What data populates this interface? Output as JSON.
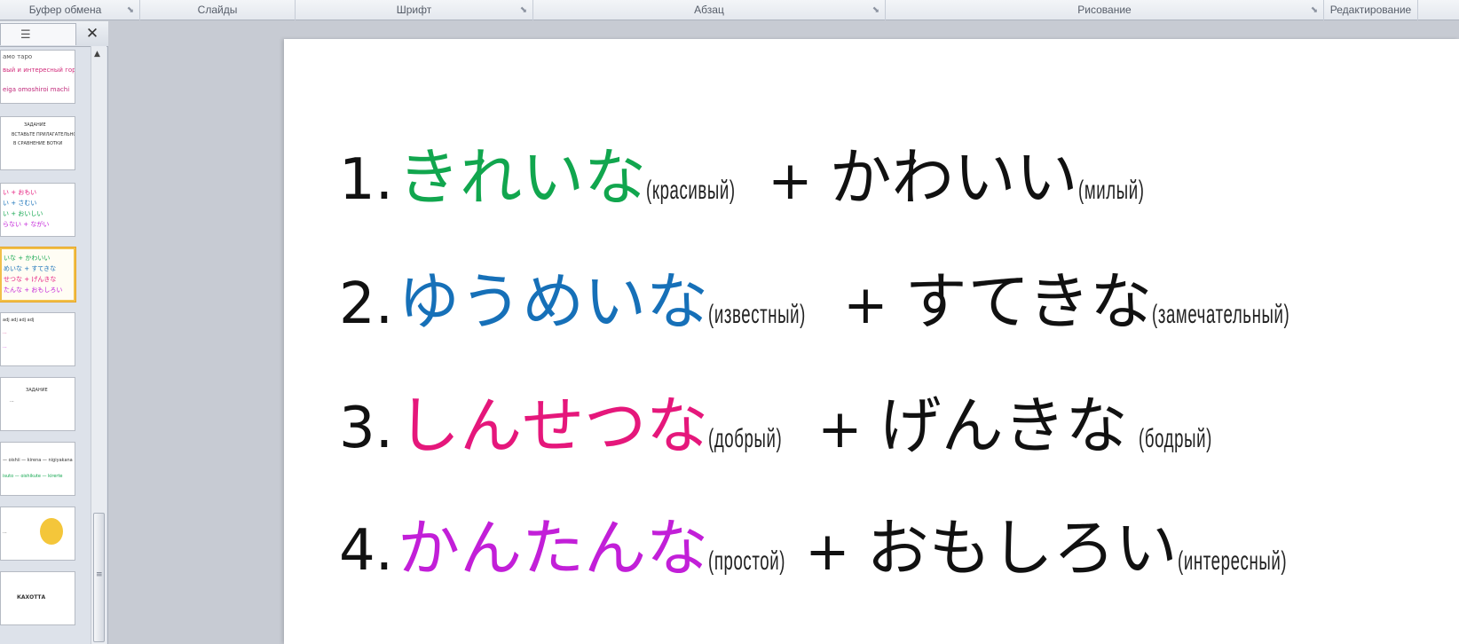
{
  "ribbon": {
    "groups": [
      {
        "label": "Буфер обмена"
      },
      {
        "label": "Слайды"
      },
      {
        "label": "Шрифт"
      },
      {
        "label": "Абзац"
      },
      {
        "label": "Рисование"
      },
      {
        "label": "Редактирование"
      }
    ]
  },
  "pane": {
    "close_glyph": "✕",
    "thumbnails": [
      {
        "lines": [
          "амо таро",
          "вый и интересный город",
          "eiga omoshiroi machi"
        ]
      },
      {
        "lines": [
          "ЗАДАНИЕ",
          "ВСТАВЬТЕ ПРИЛАГАТЕЛЬНОЕ",
          "В СРАВНЕНИЕ ВОТКИ"
        ]
      },
      {
        "lines": [
          "い + おもい",
          "い + さむい",
          "い + おいしい",
          "らない + ながい"
        ]
      },
      {
        "lines": [
          "いな + かわいい",
          "めいな + すてきな",
          "せつな + げんきな",
          "たんな + おもしろい"
        ]
      },
      {
        "lines": [
          "adj adj adj adj",
          "...",
          "..."
        ]
      },
      {
        "lines": [
          "ЗАДАНИЕ",
          "..."
        ]
      },
      {
        "lines": [
          "— oishii — kirena — nigiyakana",
          "isuto — oishikute — kirerte"
        ]
      },
      {
        "lines": [
          "..."
        ]
      },
      {
        "lines": [
          "КАХОТТА"
        ]
      }
    ]
  },
  "slide": {
    "rows": [
      {
        "num": "1.",
        "adj1": "きれいな",
        "tr1": "(красивый)",
        "plus": "+",
        "adj2": "かわいい",
        "tr2": "(милый)",
        "color": "#11a64e"
      },
      {
        "num": "2.",
        "adj1": "ゆうめいな",
        "tr1": "(известный)",
        "plus": "+",
        "adj2": "すてきな",
        "tr2": "(замечательный)",
        "color": "#1670b8"
      },
      {
        "num": "3.",
        "adj1": "しんせつな",
        "tr1": "(добрый)",
        "plus": "+",
        "adj2": "げんきな",
        "tr2": "(бодрый)",
        "color": "#e5177b"
      },
      {
        "num": "4.",
        "adj1": "かんたんな",
        "tr1": "(простой)",
        "plus": "+",
        "adj2": "おもしろい",
        "tr2": "(интересный)",
        "color": "#c21fd8"
      }
    ]
  }
}
